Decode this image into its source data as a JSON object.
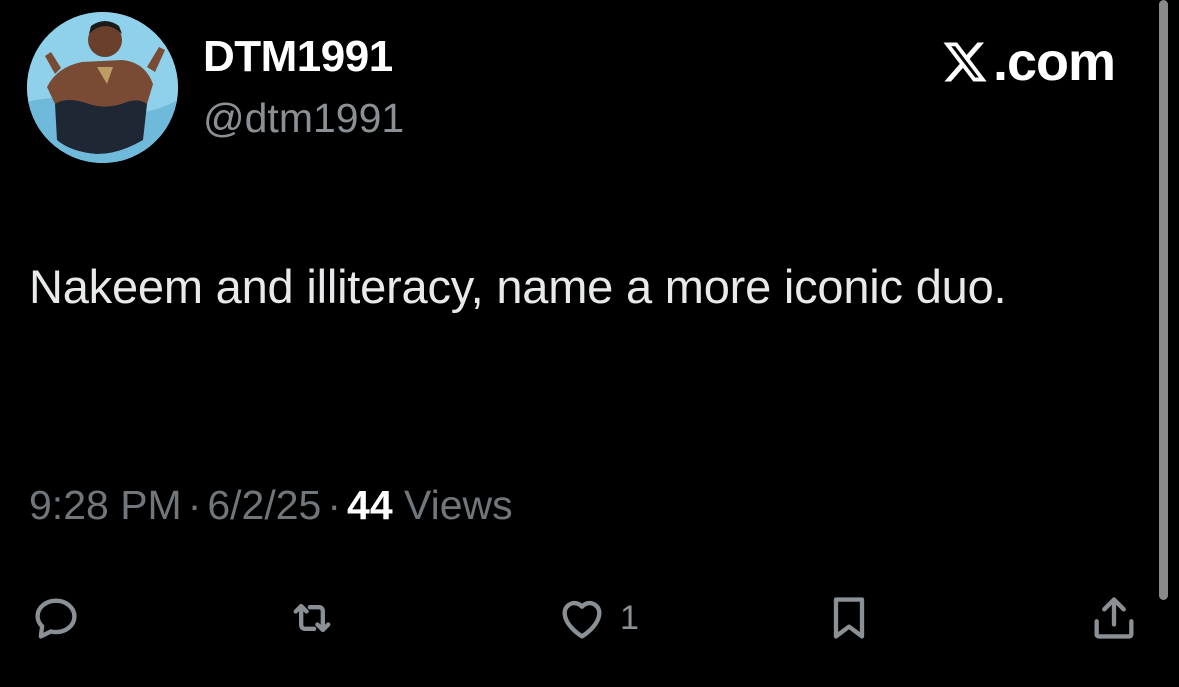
{
  "user": {
    "display_name": "DTM1991",
    "handle": "@dtm1991",
    "avatar_icon": "profile-photo"
  },
  "brand": {
    "label": ".com",
    "icon": "x-logo-icon"
  },
  "tweet": {
    "text": "Nakeem and illiteracy, name a more iconic duo."
  },
  "meta": {
    "time": "9:28 PM",
    "date": "6/2/25",
    "separator": "·",
    "views_count": "44",
    "views_label": "Views"
  },
  "actions": {
    "reply_icon": "reply-icon",
    "repost_icon": "repost-icon",
    "like_icon": "heart-icon",
    "like_count": "1",
    "bookmark_icon": "bookmark-icon",
    "share_icon": "share-icon"
  },
  "colors": {
    "background": "#000000",
    "primary_text": "#e7e9ea",
    "secondary_text": "#71767b",
    "icon": "#8b9095"
  }
}
